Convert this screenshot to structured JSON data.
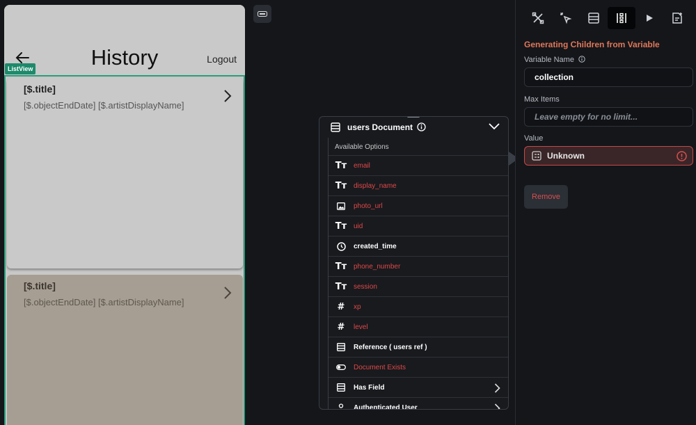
{
  "phone": {
    "title": "History",
    "logout": "Logout",
    "listview_badge": "ListView",
    "cards": [
      {
        "title": "[$.title]",
        "subtitle": "[$.objectEndDate]  [$.artistDisplayName]"
      },
      {
        "title": "[$.title]",
        "subtitle": "[$.objectEndDate]  [$.artistDisplayName]"
      }
    ]
  },
  "popup": {
    "title": "users Document",
    "section_label": "Available Options",
    "options": [
      {
        "icon": "text-type-icon",
        "label": "email",
        "style": "red"
      },
      {
        "icon": "text-type-icon",
        "label": "display_name",
        "style": "red"
      },
      {
        "icon": "image-icon",
        "label": "photo_url",
        "style": "red"
      },
      {
        "icon": "text-type-icon",
        "label": "uid",
        "style": "red"
      },
      {
        "icon": "clock-icon",
        "label": "created_time",
        "style": "white"
      },
      {
        "icon": "text-type-icon",
        "label": "phone_number",
        "style": "red"
      },
      {
        "icon": "text-type-icon",
        "label": "session",
        "style": "red"
      },
      {
        "icon": "hash-icon",
        "label": "xp",
        "style": "red"
      },
      {
        "icon": "hash-icon",
        "label": "level",
        "style": "red"
      },
      {
        "icon": "document-icon",
        "label": "Reference  ( users ref )",
        "style": "white"
      },
      {
        "icon": "toggle-icon",
        "label": "Document Exists",
        "style": "red"
      },
      {
        "icon": "document-icon",
        "label": "Has Field",
        "style": "white",
        "chevron": true
      },
      {
        "icon": "user-icon",
        "label": "Authenticated User",
        "style": "white",
        "chevron": true
      }
    ]
  },
  "panel": {
    "section_title": "Generating Children from Variable",
    "variable_name_label": "Variable Name",
    "variable_name_value": "collection",
    "max_items_label": "Max Items",
    "max_items_placeholder": "Leave empty for no limit...",
    "value_label": "Value",
    "value_value": "Unknown",
    "remove_label": "Remove"
  },
  "colors": {
    "accent_orange": "#e0775a",
    "error_red": "#d94f4f",
    "listview_green": "#1e8a6b"
  }
}
